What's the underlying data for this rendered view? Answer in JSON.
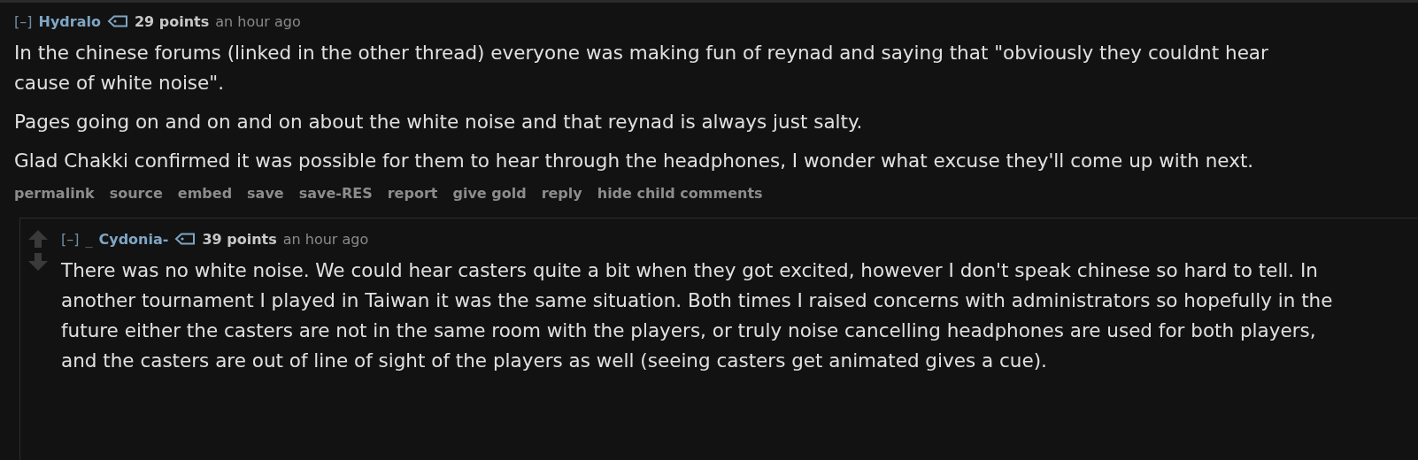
{
  "comment": {
    "toggle": "[–]",
    "author": "Hydralo",
    "points": "29 points",
    "time": "an hour ago",
    "paragraphs": [
      "In the chinese forums (linked in the other thread) everyone was making fun of reynad and saying that \"obviously they couldnt hear cause of white noise\".",
      "Pages going on and on and on about the white noise and that reynad is always just salty.",
      "Glad Chakki confirmed it was possible for them to hear through the headphones, I wonder what excuse they'll come up with next."
    ],
    "actions": [
      "permalink",
      "source",
      "embed",
      "save",
      "save-RES",
      "report",
      "give gold",
      "reply",
      "hide child comments"
    ],
    "reply": {
      "toggle": "[–]",
      "marker": "_",
      "author": "Cydonia-",
      "points": "39 points",
      "time": "an hour ago",
      "paragraphs": [
        "There was no white noise. We could hear casters quite a bit when they got excited, however I don't speak chinese so hard to tell. In another tournament I played in Taiwan it was the same situation. Both times I raised concerns with administrators so hopefully in the future either the casters are not in the same room with the players, or truly noise cancelling headphones are used for both players, and the casters are out of line of sight of the players as well (seeing casters get animated gives a cue)."
      ]
    }
  }
}
